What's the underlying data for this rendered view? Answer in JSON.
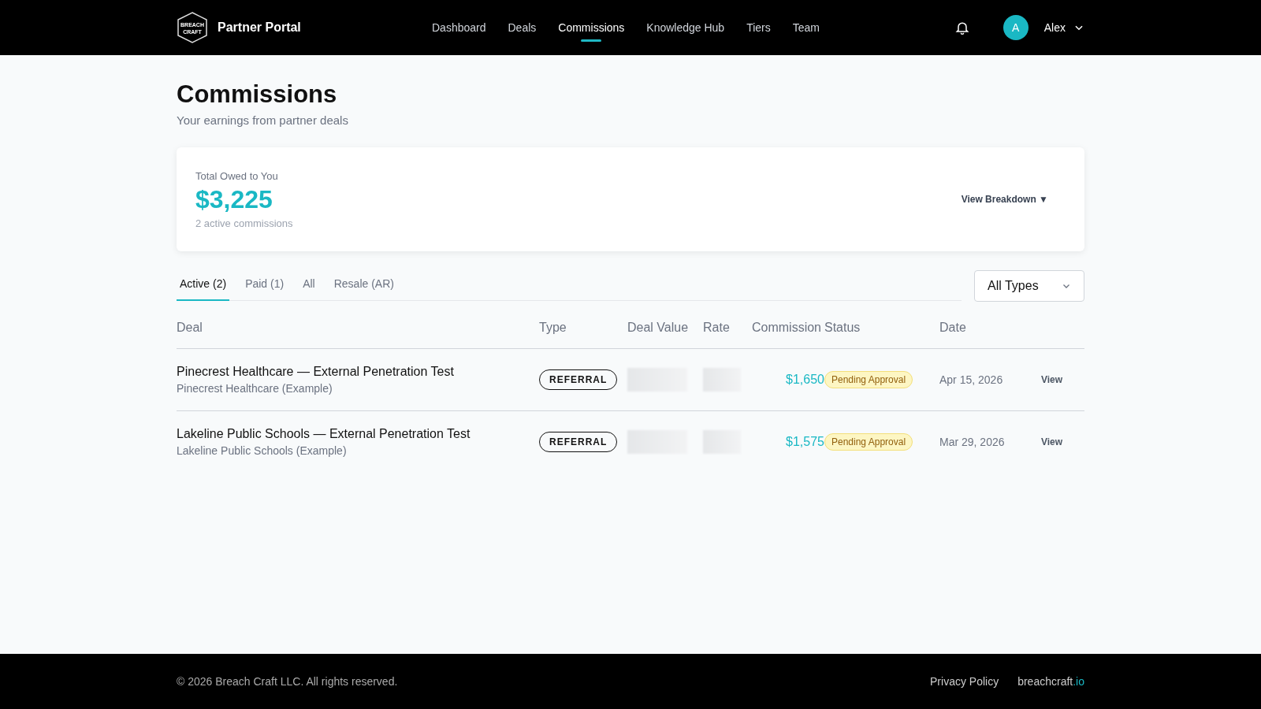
{
  "header": {
    "logo_lines": [
      "BREACH",
      "CRAFT"
    ],
    "title": "Partner Portal",
    "nav": [
      {
        "label": "Dashboard",
        "selected": false
      },
      {
        "label": "Deals",
        "selected": false
      },
      {
        "label": "Commissions",
        "selected": true
      },
      {
        "label": "Knowledge Hub",
        "selected": false
      },
      {
        "label": "Tiers",
        "selected": false
      },
      {
        "label": "Team",
        "selected": false
      }
    ],
    "user": {
      "initial": "A",
      "name": "Alex"
    }
  },
  "page": {
    "title": "Commissions",
    "subtitle": "Your earnings from partner deals"
  },
  "summary": {
    "label": "Total Owed to You",
    "amount": "$3,225",
    "note": "2 active commissions",
    "action": "View Breakdown ▼"
  },
  "tabs": [
    {
      "label": "Active (2)",
      "selected": true
    },
    {
      "label": "Paid (1)",
      "selected": false
    },
    {
      "label": "All",
      "selected": false
    },
    {
      "label": "Resale (AR)",
      "selected": false
    }
  ],
  "filter": {
    "value": "All Types"
  },
  "table": {
    "columns": [
      "Deal",
      "Type",
      "Deal Value",
      "Rate",
      "Commission",
      "Status",
      "Date"
    ],
    "rows": [
      {
        "deal": "Pinecrest Healthcare — External Penetration Test",
        "client": "Pinecrest Healthcare (Example)",
        "type": "REFERRAL",
        "commission": "$1,650",
        "status": "Pending Approval",
        "date": "Apr 15, 2026",
        "action": "View"
      },
      {
        "deal": "Lakeline Public Schools — External Penetration Test",
        "client": "Lakeline Public Schools (Example)",
        "type": "REFERRAL",
        "commission": "$1,575",
        "status": "Pending Approval",
        "date": "Mar 29, 2026",
        "action": "View"
      }
    ]
  },
  "footer": {
    "copyright": "© 2026 Breach Craft LLC. All rights reserved.",
    "links": [
      {
        "kind": "plain",
        "label": "Privacy Policy"
      },
      {
        "kind": "domain",
        "label": "breachcraft",
        "suffix": ".io"
      }
    ]
  }
}
